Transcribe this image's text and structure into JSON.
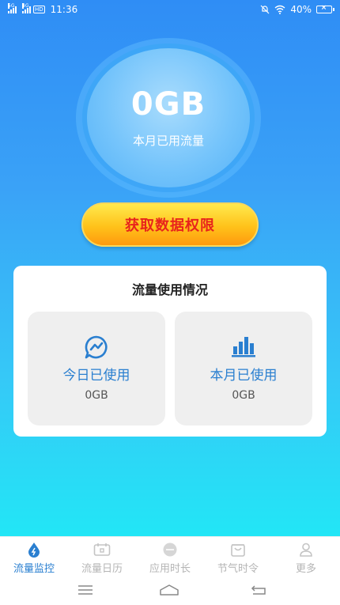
{
  "status_bar": {
    "sig1": "5G",
    "sig2": "4G",
    "hd": "HD",
    "time": "11:36",
    "battery_percent": "40%"
  },
  "usage_ring": {
    "value": "0GB",
    "label": "本月已用流量"
  },
  "permission_button": {
    "label": "获取数据权限"
  },
  "usage_card": {
    "title": "流量使用情况",
    "today": {
      "label": "今日已使用",
      "value": "0GB"
    },
    "month": {
      "label": "本月已使用",
      "value": "0GB"
    }
  },
  "bottom_nav": {
    "items": [
      {
        "label": "流量监控",
        "icon": "water-drop-icon",
        "active": true
      },
      {
        "label": "流量日历",
        "icon": "calendar-icon",
        "active": false
      },
      {
        "label": "应用时长",
        "icon": "app-timer-icon",
        "active": false
      },
      {
        "label": "节气时令",
        "icon": "shopping-bag-icon",
        "active": false
      },
      {
        "label": "更多",
        "icon": "person-icon",
        "active": false
      }
    ]
  },
  "colors": {
    "accent": "#2a7fd0",
    "button_text": "#e8241c",
    "inactive": "#b5b5b5"
  }
}
